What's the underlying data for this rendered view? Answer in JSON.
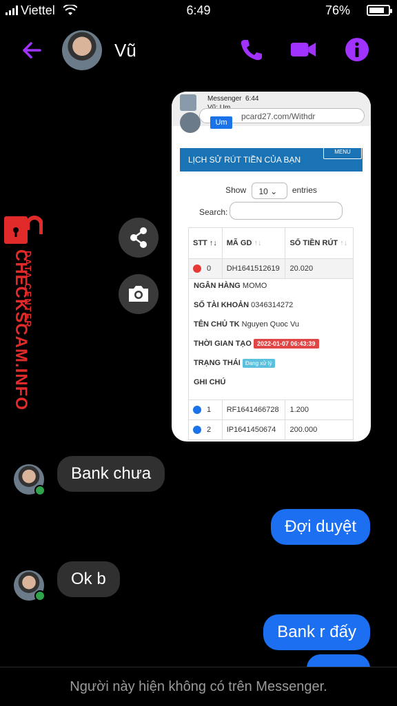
{
  "status_bar": {
    "carrier": "Viettel",
    "time": "6:49",
    "battery": "76%"
  },
  "header": {
    "contact_name": "Vũ"
  },
  "shared_image": {
    "notification": {
      "app": "Messenger",
      "time": "6:44",
      "text": "Vũ: Um"
    },
    "url_fragment": "pcard27.com/Withdr",
    "mini_button": "Um",
    "site_button": "MENU",
    "page_title": "LỊCH SỬ RÚT TIỀN CỦA BẠN",
    "show_label": "Show",
    "entries_value": "10",
    "entries_label": "entries",
    "search_label": "Search:",
    "table": {
      "headers": [
        "STT",
        "MÃ GD",
        "SỐ TIỀN RÚT"
      ],
      "rows": [
        [
          "0",
          "DH1641512619",
          "20.020"
        ],
        [
          "1",
          "RF1641466728",
          "1.200"
        ],
        [
          "2",
          "IP1641450674",
          "200.000"
        ]
      ]
    },
    "detail": {
      "bank_label": "NGÂN HÀNG",
      "bank_value": "MOMO",
      "account_label": "SỐ TÀI KHOẢN",
      "account_value": "0346314272",
      "owner_label": "TÊN CHỦ TK",
      "owner_value": "Nguyen Quoc Vu",
      "created_label": "THỜI GIAN TẠO",
      "created_value": "2022-01-07 06:43:39",
      "status_label": "TRẠNG THÁI",
      "status_value": "Đang xử lý",
      "note_label": "GHI CHÚ"
    }
  },
  "watermark": {
    "main": "CHECKSCAM.INFO",
    "sub": "DATA CENTER"
  },
  "messages": [
    {
      "side": "in",
      "text": "Bank chưa"
    },
    {
      "side": "out",
      "text": "Đợi duyệt"
    },
    {
      "side": "in",
      "text": "Ok b"
    },
    {
      "side": "out",
      "text": "Bank r đấy"
    }
  ],
  "footer": {
    "text": "Người này hiện không có trên Messenger."
  },
  "colors": {
    "accent": "#a033ff",
    "outgoing": "#1b6ff0",
    "watermark": "#e12a2a"
  }
}
